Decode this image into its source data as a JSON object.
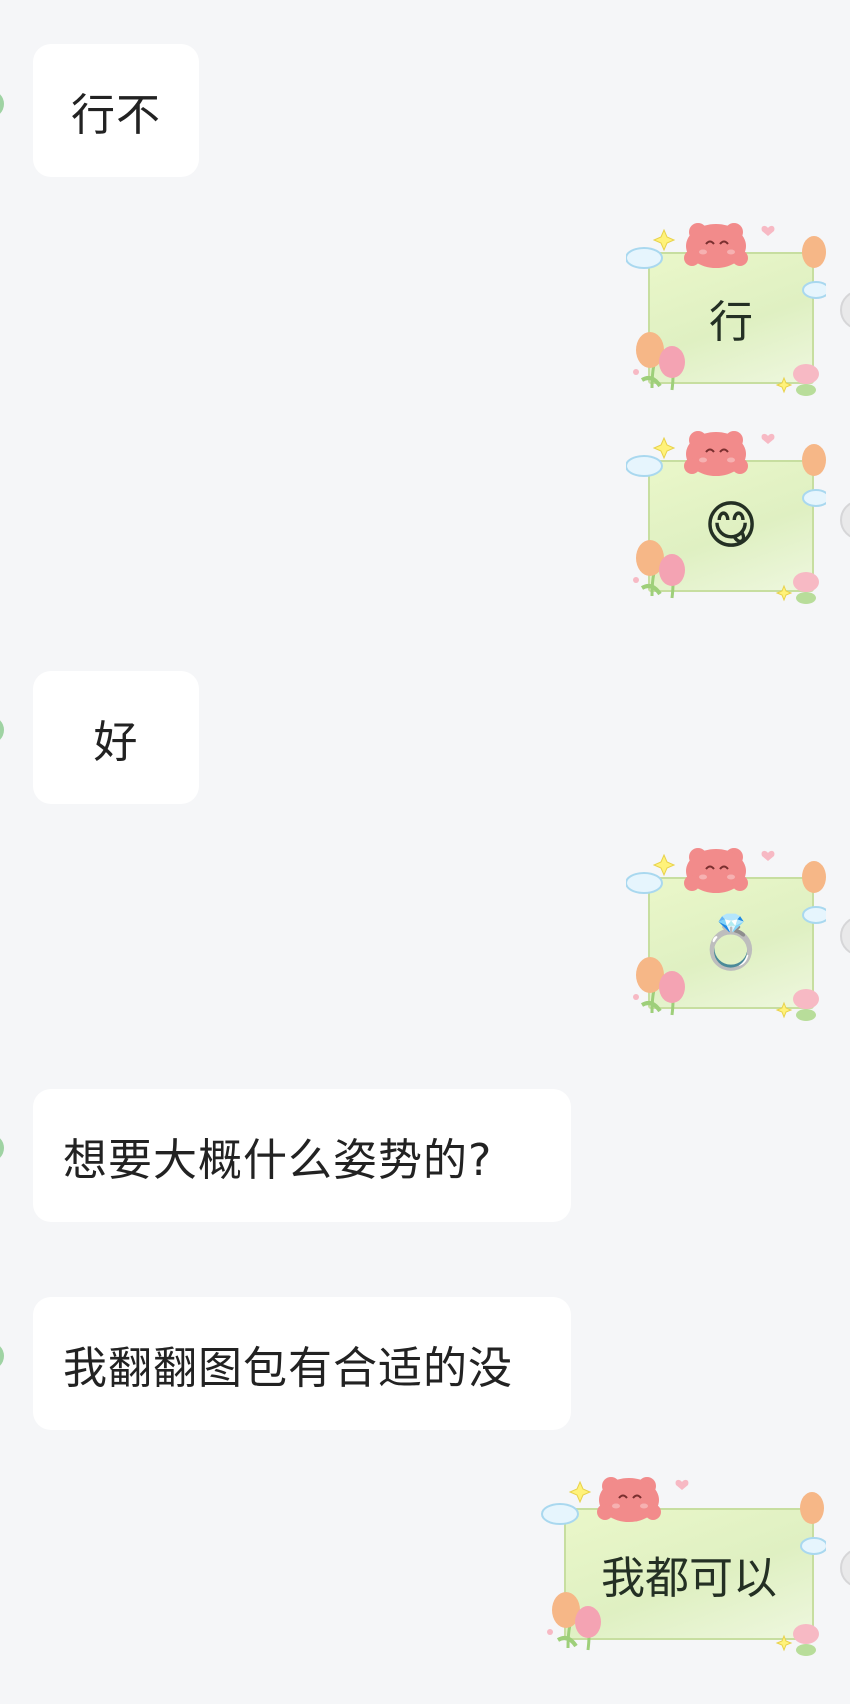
{
  "messages": [
    {
      "side": "left",
      "text": "行不"
    },
    {
      "side": "right",
      "text": "行"
    },
    {
      "side": "right",
      "text": "😋"
    },
    {
      "side": "left",
      "text": "好"
    },
    {
      "side": "right",
      "text": "💍"
    },
    {
      "side": "left",
      "text": "想要大概什么姿势的?"
    },
    {
      "side": "left",
      "text": "我翻翻图包有合适的没"
    },
    {
      "side": "right",
      "text": "我都可以"
    }
  ],
  "colors": {
    "background": "#f5f6f8",
    "left_bubble": "#ffffff",
    "sticker_card": "#e3f3c6",
    "sticker_border": "#c7dea0",
    "bear": "#f28b8b",
    "tulip_orange": "#f6b787",
    "tulip_pink": "#f4a3b3",
    "cloud": "#d6eefa",
    "star": "#fff27a"
  },
  "icons": [
    "bear-icon",
    "tulip-icon",
    "cloud-icon",
    "star-icon",
    "heart-icon"
  ]
}
